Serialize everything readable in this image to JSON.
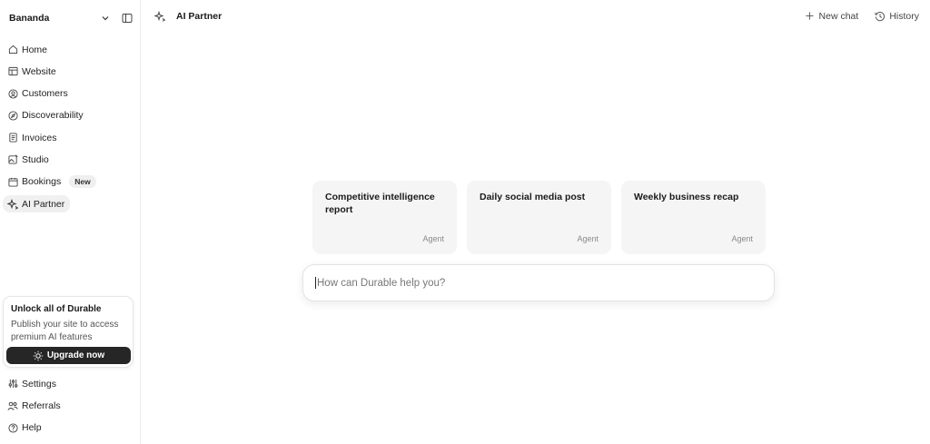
{
  "workspace": {
    "name": "Bananda"
  },
  "sidebar": {
    "items": [
      {
        "label": "Home",
        "icon": "home-icon"
      },
      {
        "label": "Website",
        "icon": "layout-icon"
      },
      {
        "label": "Customers",
        "icon": "user-circle-icon"
      },
      {
        "label": "Discoverability",
        "icon": "compass-icon"
      },
      {
        "label": "Invoices",
        "icon": "receipt-icon"
      },
      {
        "label": "Studio",
        "icon": "image-edit-icon"
      },
      {
        "label": "Bookings",
        "icon": "calendar-icon",
        "badge": "New"
      },
      {
        "label": "AI Partner",
        "icon": "sparkle-icon",
        "active": true
      }
    ],
    "upgrade": {
      "title": "Unlock all of Durable",
      "description": "Publish your site to access premium AI features",
      "button": "Upgrade now"
    },
    "bottom_items": [
      {
        "label": "Settings",
        "icon": "sliders-icon"
      },
      {
        "label": "Referrals",
        "icon": "users-icon"
      },
      {
        "label": "Help",
        "icon": "help-icon"
      }
    ]
  },
  "header": {
    "title": "AI Partner",
    "new_chat": "New chat",
    "history": "History"
  },
  "cards": [
    {
      "title": "Competitive intelligence report",
      "kind": "Agent"
    },
    {
      "title": "Daily social media post",
      "kind": "Agent"
    },
    {
      "title": "Weekly business recap",
      "kind": "Agent"
    }
  ],
  "prompt": {
    "placeholder": "How can Durable help you?",
    "value": ""
  }
}
